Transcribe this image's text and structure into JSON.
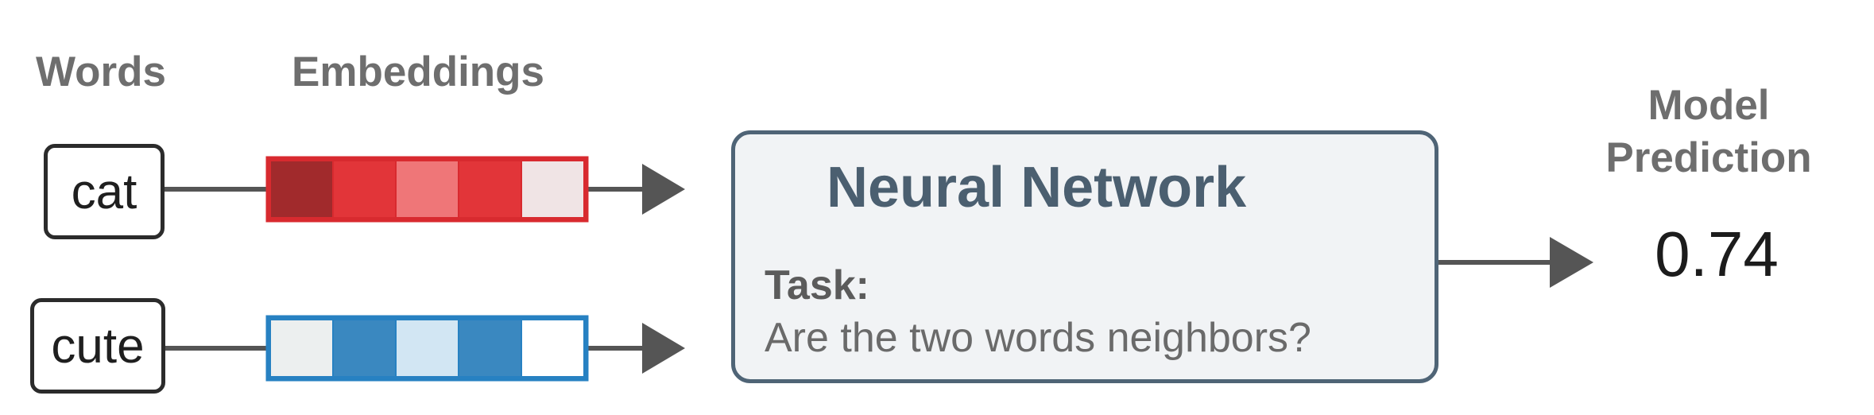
{
  "headers": {
    "words": "Words",
    "embeddings": "Embeddings",
    "model_line1": "Model",
    "model_line2": "Prediction"
  },
  "words": [
    {
      "text": "cat",
      "embedding_border": "#d82a2f",
      "embedding_colors": [
        "#a12a2c",
        "#e23539",
        "#ef7678",
        "#e23539",
        "#f0e4e5"
      ]
    },
    {
      "text": "cute",
      "embedding_border": "#2781c2",
      "embedding_colors": [
        "#ecefef",
        "#3a88c0",
        "#d2e6f3",
        "#3a88c0",
        "#ffffff"
      ]
    }
  ],
  "network": {
    "title": "Neural Network",
    "task_label": "Task:",
    "task_text": "Are the two words neighbors?"
  },
  "prediction": "0.74",
  "colors": {
    "line": "#555555",
    "network_border": "#4f6476",
    "network_fill": "#f1f3f5"
  }
}
